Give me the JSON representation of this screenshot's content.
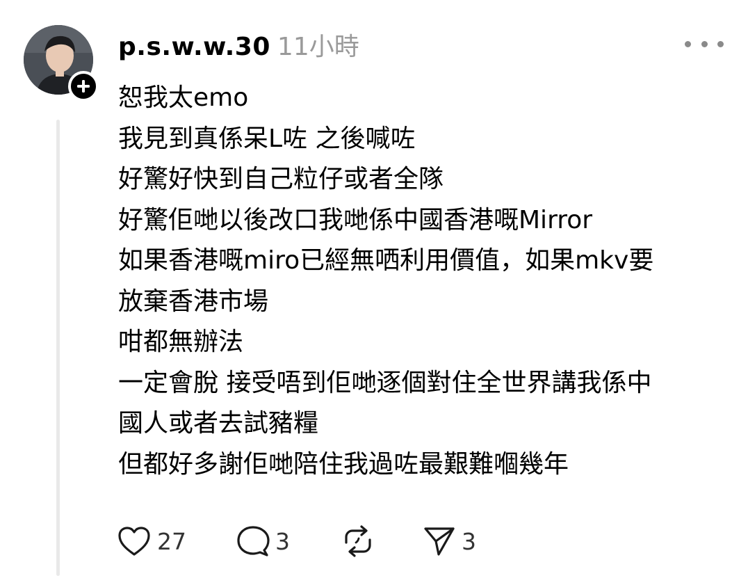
{
  "post": {
    "author": {
      "username": "p.s.w.w.30",
      "avatar_icon": "profile-photo",
      "follow_icon": "plus-icon"
    },
    "timestamp": "11小時",
    "more_icon": "more-horizontal-icon",
    "body_lines": [
      "恕我太emo",
      "我見到真係呆L咗 之後喊咗",
      "好驚好快到自己粒仔或者全隊",
      "好驚佢哋以後改口我哋係中國香港嘅Mirror",
      "如果香港嘅miro已經無哂利用價值，如果mkv要",
      "放棄香港市場",
      "咁都無辦法",
      "一定會脫 接受唔到佢哋逐個對住全世界講我係中",
      "國人或者去試豬糧",
      "但都好多謝佢哋陪住我過咗最艱難嗰幾年"
    ],
    "actions": {
      "like": {
        "icon": "heart-icon",
        "count": "27"
      },
      "reply": {
        "icon": "comment-icon",
        "count": "3"
      },
      "repost": {
        "icon": "repost-icon",
        "count": ""
      },
      "share": {
        "icon": "send-icon",
        "count": "3"
      }
    }
  },
  "colors": {
    "text": "#000000",
    "muted": "#9a9a9a",
    "thread_line": "#e9e9e9",
    "icon": "#1a1a1a"
  }
}
